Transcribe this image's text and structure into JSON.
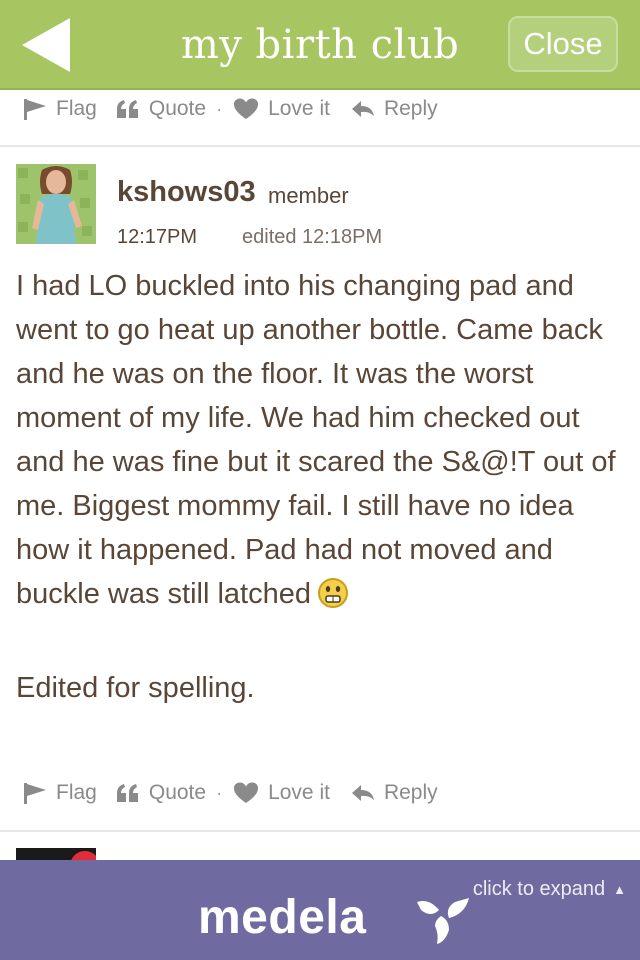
{
  "header": {
    "title": "my birth club",
    "close_label": "Close",
    "color": "#a7c662"
  },
  "actions": {
    "flag": "Flag",
    "quote": "Quote",
    "separator": "·",
    "love": "Love it",
    "reply": "Reply"
  },
  "post": {
    "username": "kshows03",
    "role": "member",
    "time": "12:17PM",
    "edited": "edited 12:18PM",
    "text": "I had LO buckled into his changing pad and went to go heat up another bottle. Came back and he was on the floor. It was the worst moment of my life. We had him checked out and he was fine but it scared the S&@!T out of me. Biggest mommy fail. I still have no idea how it happened. Pad had not moved and buckle was still latched",
    "edit_note": "Edited for spelling.",
    "emoji": "worried-face-icon"
  },
  "ad": {
    "expand_label": "click to expand",
    "brand": "medela",
    "color": "#6f6a9f"
  }
}
